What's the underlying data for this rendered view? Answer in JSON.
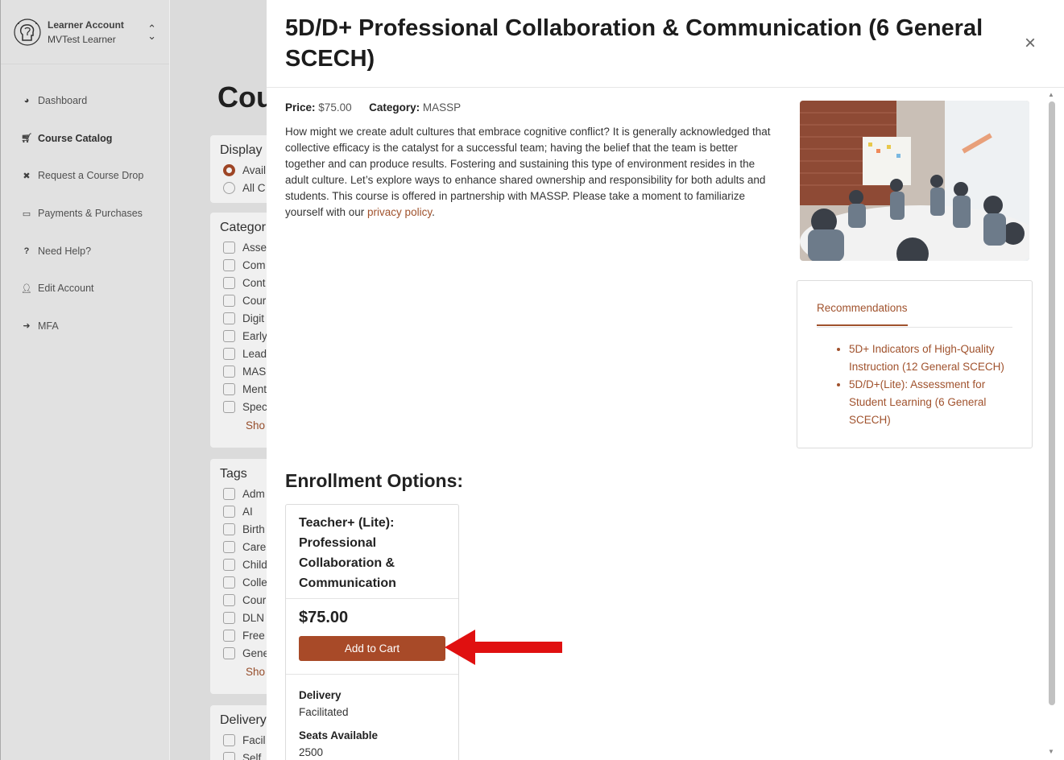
{
  "sidebar": {
    "account_title": "Learner Account",
    "account_name": "MVTest Learner",
    "items": [
      {
        "label": "Dashboard",
        "icon": "pie-chart-icon"
      },
      {
        "label": "Course Catalog",
        "icon": "cart-icon"
      },
      {
        "label": "Request a Course Drop",
        "icon": "x-icon"
      },
      {
        "label": "Payments & Purchases",
        "icon": "credit-card-icon"
      },
      {
        "label": "Need Help?",
        "icon": "question-icon"
      },
      {
        "label": "Edit Account",
        "icon": "user-icon"
      },
      {
        "label": "MFA",
        "icon": "sign-in-icon"
      }
    ]
  },
  "background": {
    "page_title": "Cou",
    "display": {
      "title": "Display",
      "options": [
        "Avail",
        "All C"
      ]
    },
    "categories": {
      "title": "Categor",
      "items": [
        "Asse",
        "Com",
        "Cont",
        "Cour",
        "Digit",
        "Early",
        "Lead",
        "MAS",
        "Ment",
        "Spec"
      ],
      "show_more": "Sho"
    },
    "tags": {
      "title": "Tags",
      "items": [
        "Adm",
        "AI",
        "Birth",
        "Care",
        "Child",
        "Colle",
        "Cour",
        "DLN",
        "Free",
        "Gene"
      ],
      "show_more": "Sho"
    },
    "delivery": {
      "title": "Delivery",
      "items": [
        "Facil",
        "Self"
      ]
    }
  },
  "modal": {
    "title": "5D/D+ Professional Collaboration & Communication (6 General SCECH)",
    "close_symbol": "×",
    "price_label": "Price:",
    "price": "$75.00",
    "category_label": "Category:",
    "category": "MASSP",
    "description": "How might we create adult cultures that embrace cognitive conflict? It is generally acknowledged that collective efficacy is the catalyst for a successful team; having the belief that the team is better together and can produce results. Fostering and sustaining this type of environment resides in the adult culture. Let’s explore ways to enhance shared ownership and responsibility for both adults and students. This course is offered in partnership with MASSP. Please take a moment to familiarize yourself with our ",
    "privacy_link": "privacy policy",
    "description_end": ".",
    "recommendations": {
      "tab": "Recommendations",
      "items": [
        "5D+ Indicators of High-Quality Instruction (12 General SCECH)",
        "5D/D+(Lite): Assessment for Student Learning (6 General SCECH)"
      ]
    },
    "enrollment_title": "Enrollment Options:",
    "option": {
      "name": "Teacher+ (Lite): Professional Collaboration & Communication",
      "price": "$75.00",
      "button": "Add to Cart",
      "delivery_label": "Delivery",
      "delivery": "Facilitated",
      "seats_label": "Seats Available",
      "seats": "2500"
    }
  },
  "colors": {
    "accent": "#a84a28",
    "link": "#a0522d",
    "annotation_arrow": "#e01010"
  }
}
